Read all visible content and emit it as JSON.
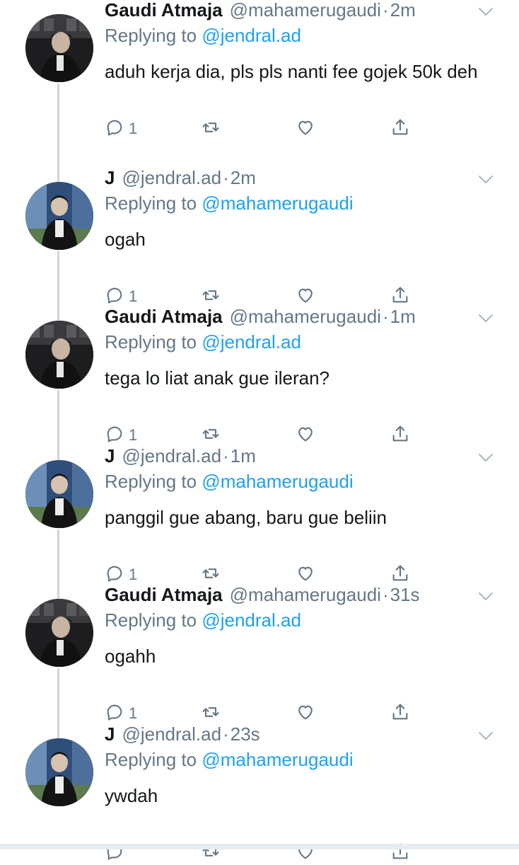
{
  "tweets": [
    {
      "name": "Gaudi Atmaja",
      "handle": "@mahamerugaudi",
      "sep": "·",
      "time": "2m",
      "replying_label": "Replying to",
      "replying_to": "@jendral.ad",
      "text": "aduh kerja dia, pls pls nanti fee gojek 50k deh",
      "reply_count": "1"
    },
    {
      "name": "J",
      "handle": "@jendral.ad",
      "sep": "·",
      "time": "2m",
      "replying_label": "Replying to",
      "replying_to": "@mahamerugaudi",
      "text": "ogah",
      "reply_count": "1"
    },
    {
      "name": "Gaudi Atmaja",
      "handle": "@mahamerugaudi",
      "sep": "·",
      "time": "1m",
      "replying_label": "Replying to",
      "replying_to": "@jendral.ad",
      "text": "tega lo liat anak gue ileran?",
      "reply_count": "1"
    },
    {
      "name": "J",
      "handle": "@jendral.ad",
      "sep": "·",
      "time": "1m",
      "replying_label": "Replying to",
      "replying_to": "@mahamerugaudi",
      "text": "panggil gue abang, baru gue beliin",
      "reply_count": "1"
    },
    {
      "name": "Gaudi Atmaja",
      "handle": "@mahamerugaudi",
      "sep": "·",
      "time": "31s",
      "replying_label": "Replying to",
      "replying_to": "@jendral.ad",
      "text": "ogahh",
      "reply_count": "1"
    },
    {
      "name": "J",
      "handle": "@jendral.ad",
      "sep": "·",
      "time": "23s",
      "replying_label": "Replying to",
      "replying_to": "@mahamerugaudi",
      "text": "ywdah",
      "reply_count": ""
    }
  ],
  "colors": {
    "link": "#1da1f2",
    "secondary_text": "#657786",
    "primary_text": "#14171a",
    "thread_line": "#ccd6dd"
  },
  "icons": [
    "reply-icon",
    "retweet-icon",
    "like-icon",
    "share-icon",
    "chevron-down-icon",
    "avatar"
  ]
}
